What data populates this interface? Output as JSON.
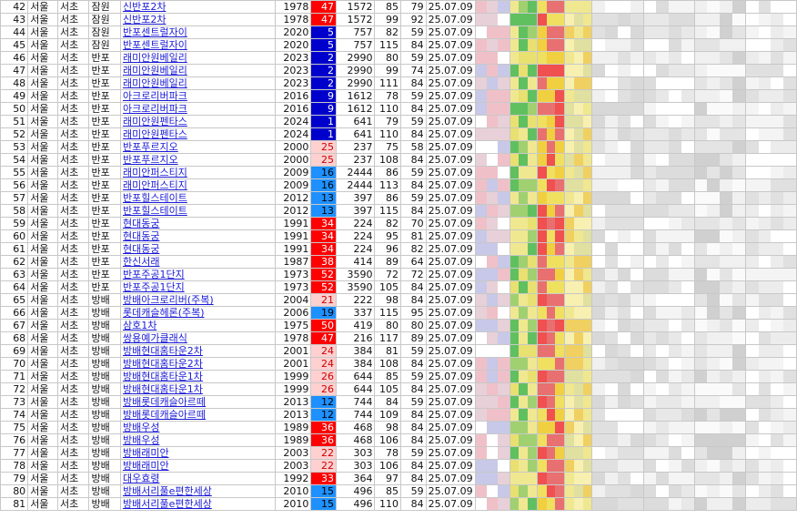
{
  "colors": {
    "rank_very_high": "#ff0000",
    "rank_high": "#ff7b7b",
    "rank_mid": "#ffd0d0",
    "rank_low": "#1e90ff",
    "rank_top": "#0000cc",
    "grid": "#c8c8c8",
    "link": "#1a1ad6"
  },
  "rows": [
    {
      "no": "42",
      "si": "서울",
      "gu": "서초",
      "dong": "잠원",
      "name": "신반포2차",
      "year": "1978",
      "rank": "47",
      "hh": "1572",
      "area": "85",
      "py": "79",
      "date": "25.07.09"
    },
    {
      "no": "43",
      "si": "서울",
      "gu": "서초",
      "dong": "잠원",
      "name": "신반포2차",
      "year": "1978",
      "rank": "47",
      "hh": "1572",
      "area": "99",
      "py": "92",
      "date": "25.07.09"
    },
    {
      "no": "44",
      "si": "서울",
      "gu": "서초",
      "dong": "잠원",
      "name": "반포센트럴자이",
      "year": "2020",
      "rank": "5",
      "hh": "757",
      "area": "82",
      "py": "59",
      "date": "25.07.09"
    },
    {
      "no": "45",
      "si": "서울",
      "gu": "서초",
      "dong": "잠원",
      "name": "반포센트럴자이",
      "year": "2020",
      "rank": "5",
      "hh": "757",
      "area": "115",
      "py": "84",
      "date": "25.07.09"
    },
    {
      "no": "46",
      "si": "서울",
      "gu": "서초",
      "dong": "반포",
      "name": "래미안원베일리",
      "year": "2023",
      "rank": "2",
      "hh": "2990",
      "area": "80",
      "py": "59",
      "date": "25.07.09"
    },
    {
      "no": "47",
      "si": "서울",
      "gu": "서초",
      "dong": "반포",
      "name": "래미안원베일리",
      "year": "2023",
      "rank": "2",
      "hh": "2990",
      "area": "99",
      "py": "74",
      "date": "25.07.09"
    },
    {
      "no": "48",
      "si": "서울",
      "gu": "서초",
      "dong": "반포",
      "name": "래미안원베일리",
      "year": "2023",
      "rank": "2",
      "hh": "2990",
      "area": "111",
      "py": "84",
      "date": "25.07.09"
    },
    {
      "no": "49",
      "si": "서울",
      "gu": "서초",
      "dong": "반포",
      "name": "아크로리버파크",
      "year": "2016",
      "rank": "9",
      "hh": "1612",
      "area": "78",
      "py": "59",
      "date": "25.07.09"
    },
    {
      "no": "50",
      "si": "서울",
      "gu": "서초",
      "dong": "반포",
      "name": "아크로리버파크",
      "year": "2016",
      "rank": "9",
      "hh": "1612",
      "area": "110",
      "py": "84",
      "date": "25.07.09"
    },
    {
      "no": "51",
      "si": "서울",
      "gu": "서초",
      "dong": "반포",
      "name": "래미안원펜타스",
      "year": "2024",
      "rank": "1",
      "hh": "641",
      "area": "79",
      "py": "59",
      "date": "25.07.09"
    },
    {
      "no": "52",
      "si": "서울",
      "gu": "서초",
      "dong": "반포",
      "name": "래미안원펜타스",
      "year": "2024",
      "rank": "1",
      "hh": "641",
      "area": "110",
      "py": "84",
      "date": "25.07.09"
    },
    {
      "no": "53",
      "si": "서울",
      "gu": "서초",
      "dong": "반포",
      "name": "반포푸르지오",
      "year": "2000",
      "rank": "25",
      "hh": "237",
      "area": "75",
      "py": "58",
      "date": "25.07.09"
    },
    {
      "no": "54",
      "si": "서울",
      "gu": "서초",
      "dong": "반포",
      "name": "반포푸르지오",
      "year": "2000",
      "rank": "25",
      "hh": "237",
      "area": "108",
      "py": "84",
      "date": "25.07.09"
    },
    {
      "no": "55",
      "si": "서울",
      "gu": "서초",
      "dong": "반포",
      "name": "래미안퍼스티지",
      "year": "2009",
      "rank": "16",
      "hh": "2444",
      "area": "86",
      "py": "59",
      "date": "25.07.09"
    },
    {
      "no": "56",
      "si": "서울",
      "gu": "서초",
      "dong": "반포",
      "name": "래미안퍼스티지",
      "year": "2009",
      "rank": "16",
      "hh": "2444",
      "area": "113",
      "py": "84",
      "date": "25.07.09"
    },
    {
      "no": "57",
      "si": "서울",
      "gu": "서초",
      "dong": "반포",
      "name": "반포힐스테이트",
      "year": "2012",
      "rank": "13",
      "hh": "397",
      "area": "86",
      "py": "59",
      "date": "25.07.09"
    },
    {
      "no": "58",
      "si": "서울",
      "gu": "서초",
      "dong": "반포",
      "name": "반포힐스테이트",
      "year": "2012",
      "rank": "13",
      "hh": "397",
      "area": "115",
      "py": "84",
      "date": "25.07.09"
    },
    {
      "no": "59",
      "si": "서울",
      "gu": "서초",
      "dong": "반포",
      "name": "현대동궁",
      "year": "1991",
      "rank": "34",
      "hh": "224",
      "area": "82",
      "py": "70",
      "date": "25.07.09"
    },
    {
      "no": "60",
      "si": "서울",
      "gu": "서초",
      "dong": "반포",
      "name": "현대동궁",
      "year": "1991",
      "rank": "34",
      "hh": "224",
      "area": "95",
      "py": "81",
      "date": "25.07.09"
    },
    {
      "no": "61",
      "si": "서울",
      "gu": "서초",
      "dong": "반포",
      "name": "현대동궁",
      "year": "1991",
      "rank": "34",
      "hh": "224",
      "area": "96",
      "py": "82",
      "date": "25.07.09"
    },
    {
      "no": "62",
      "si": "서울",
      "gu": "서초",
      "dong": "반포",
      "name": "한신서래",
      "year": "1987",
      "rank": "38",
      "hh": "414",
      "area": "89",
      "py": "64",
      "date": "25.07.09"
    },
    {
      "no": "63",
      "si": "서울",
      "gu": "서초",
      "dong": "반포",
      "name": "반포주공1단지",
      "year": "1973",
      "rank": "52",
      "hh": "3590",
      "area": "72",
      "py": "72",
      "date": "25.07.09"
    },
    {
      "no": "64",
      "si": "서울",
      "gu": "서초",
      "dong": "반포",
      "name": "반포주공1단지",
      "year": "1973",
      "rank": "52",
      "hh": "3590",
      "area": "105",
      "py": "84",
      "date": "25.07.09"
    },
    {
      "no": "65",
      "si": "서울",
      "gu": "서초",
      "dong": "방배",
      "name": "방배아크로리버(주복)",
      "year": "2004",
      "rank": "21",
      "hh": "222",
      "area": "98",
      "py": "84",
      "date": "25.07.09"
    },
    {
      "no": "66",
      "si": "서울",
      "gu": "서초",
      "dong": "방배",
      "name": "롯데캐슬헤론(주복)",
      "year": "2006",
      "rank": "19",
      "hh": "337",
      "area": "115",
      "py": "95",
      "date": "25.07.09"
    },
    {
      "no": "67",
      "si": "서울",
      "gu": "서초",
      "dong": "방배",
      "name": "삼호1차",
      "year": "1975",
      "rank": "50",
      "hh": "419",
      "area": "80",
      "py": "80",
      "date": "25.07.09"
    },
    {
      "no": "68",
      "si": "서울",
      "gu": "서초",
      "dong": "방배",
      "name": "쌍용예가클래식",
      "year": "1978",
      "rank": "47",
      "hh": "216",
      "area": "117",
      "py": "89",
      "date": "25.07.09"
    },
    {
      "no": "69",
      "si": "서울",
      "gu": "서초",
      "dong": "방배",
      "name": "방배현대홈타운2차",
      "year": "2001",
      "rank": "24",
      "hh": "384",
      "area": "81",
      "py": "59",
      "date": "25.07.09"
    },
    {
      "no": "70",
      "si": "서울",
      "gu": "서초",
      "dong": "방배",
      "name": "방배현대홈타운2차",
      "year": "2001",
      "rank": "24",
      "hh": "384",
      "area": "108",
      "py": "84",
      "date": "25.07.09"
    },
    {
      "no": "71",
      "si": "서울",
      "gu": "서초",
      "dong": "방배",
      "name": "방배현대홈타운1차",
      "year": "1999",
      "rank": "26",
      "hh": "644",
      "area": "85",
      "py": "59",
      "date": "25.07.09"
    },
    {
      "no": "72",
      "si": "서울",
      "gu": "서초",
      "dong": "방배",
      "name": "방배현대홈타운1차",
      "year": "1999",
      "rank": "26",
      "hh": "644",
      "area": "105",
      "py": "84",
      "date": "25.07.09"
    },
    {
      "no": "73",
      "si": "서울",
      "gu": "서초",
      "dong": "방배",
      "name": "방배롯데캐슬아르떼",
      "year": "2013",
      "rank": "12",
      "hh": "744",
      "area": "84",
      "py": "59",
      "date": "25.07.09"
    },
    {
      "no": "74",
      "si": "서울",
      "gu": "서초",
      "dong": "방배",
      "name": "방배롯데캐슬아르떼",
      "year": "2013",
      "rank": "12",
      "hh": "744",
      "area": "109",
      "py": "84",
      "date": "25.07.09"
    },
    {
      "no": "75",
      "si": "서울",
      "gu": "서초",
      "dong": "방배",
      "name": "방배우성",
      "year": "1989",
      "rank": "36",
      "hh": "468",
      "area": "98",
      "py": "84",
      "date": "25.07.09"
    },
    {
      "no": "76",
      "si": "서울",
      "gu": "서초",
      "dong": "방배",
      "name": "방배우성",
      "year": "1989",
      "rank": "36",
      "hh": "468",
      "area": "106",
      "py": "84",
      "date": "25.07.09"
    },
    {
      "no": "77",
      "si": "서울",
      "gu": "서초",
      "dong": "방배",
      "name": "방배래미안",
      "year": "2003",
      "rank": "22",
      "hh": "303",
      "area": "78",
      "py": "59",
      "date": "25.07.09"
    },
    {
      "no": "78",
      "si": "서울",
      "gu": "서초",
      "dong": "방배",
      "name": "방배래미안",
      "year": "2003",
      "rank": "22",
      "hh": "303",
      "area": "106",
      "py": "84",
      "date": "25.07.09"
    },
    {
      "no": "79",
      "si": "서울",
      "gu": "서초",
      "dong": "방배",
      "name": "대우효령",
      "year": "1992",
      "rank": "33",
      "hh": "364",
      "area": "97",
      "py": "84",
      "date": "25.07.09"
    },
    {
      "no": "80",
      "si": "서울",
      "gu": "서초",
      "dong": "방배",
      "name": "방배서리풀e편한세상",
      "year": "2010",
      "rank": "15",
      "hh": "496",
      "area": "85",
      "py": "59",
      "date": "25.07.09"
    },
    {
      "no": "81",
      "si": "서울",
      "gu": "서초",
      "dong": "방배",
      "name": "방배서리풀e편한세상",
      "year": "2010",
      "rank": "15",
      "hh": "496",
      "area": "110",
      "py": "84",
      "date": "25.07.09"
    }
  ]
}
